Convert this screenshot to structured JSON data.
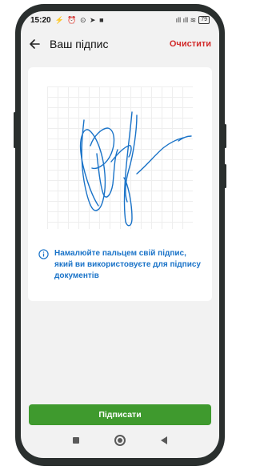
{
  "status": {
    "time": "15:20",
    "left_icons": "⚡ ⏰ ⊙ ➤ ■",
    "right_icons": "ıll ıll ≋",
    "battery": "79"
  },
  "appbar": {
    "title": "Ваш підпис",
    "clear_label": "Очистити"
  },
  "hint": {
    "text": "Намалюйте пальцем свій підпис, який ви використовуєте для підпису документів"
  },
  "primary_button": {
    "label": "Підписати"
  },
  "colors": {
    "accent_green": "#3f9a2e",
    "danger_red": "#d22b2b",
    "info_blue": "#1a73c8",
    "signature_blue": "#1a73c8"
  }
}
